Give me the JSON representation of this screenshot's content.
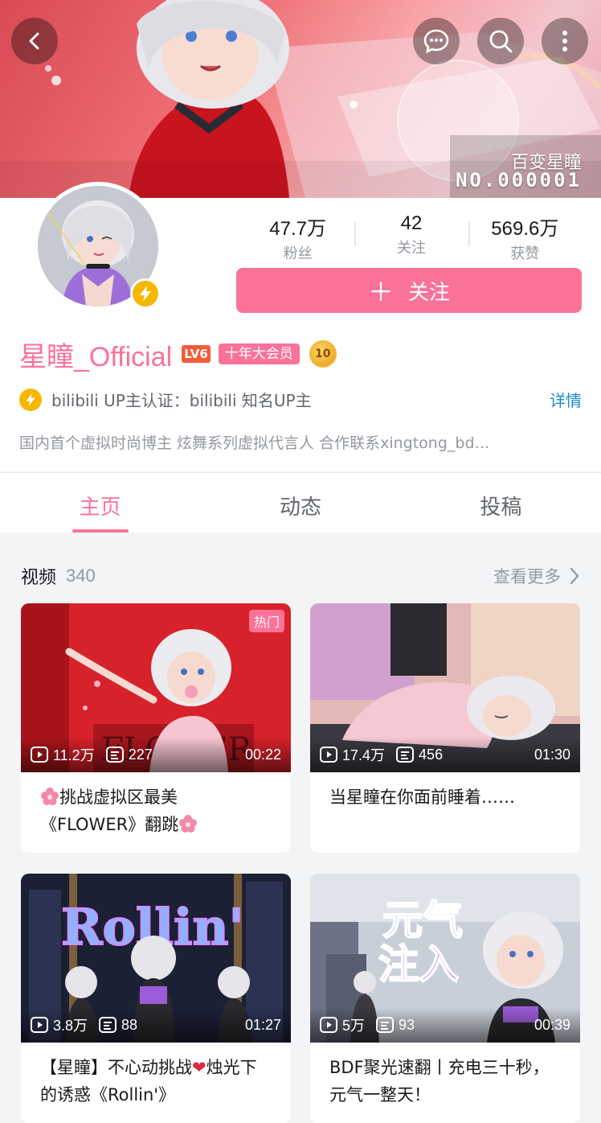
{
  "banner": {
    "badge_name": "百变星瞳",
    "badge_no": "NO.000001"
  },
  "header": {
    "back_icon": "back-arrow-icon",
    "message_icon": "message-icon",
    "search_icon": "search-icon",
    "more_icon": "more-vertical-icon"
  },
  "stats": [
    {
      "value": "47.7万",
      "label": "粉丝"
    },
    {
      "value": "42",
      "label": "关注"
    },
    {
      "value": "569.6万",
      "label": "获赞"
    }
  ],
  "follow_button": {
    "plus": "＋",
    "label": "关注"
  },
  "user": {
    "name": "星瞳_Official",
    "level": "LV6",
    "vip": "十年大会员",
    "medal": "10"
  },
  "verify": {
    "text": "bilibili UP主认证：bilibili 知名UP主",
    "detail_link": "详情"
  },
  "bio": "国内首个虚拟时尚博主 炫舞系列虚拟代言人 合作联系xingtong_bd…",
  "tabs": [
    "主页",
    "动态",
    "投稿"
  ],
  "videos": {
    "title": "视频",
    "count": "340",
    "more": "查看更多",
    "items": [
      {
        "plays": "11.2万",
        "danmaku": "227",
        "duration": "00:22",
        "badge": "热门",
        "title_a": "挑战虚拟区最美",
        "title_b": "《FLOWER》翻跳"
      },
      {
        "plays": "17.4万",
        "danmaku": "456",
        "duration": "01:30",
        "title": "当星瞳在你面前睡着……"
      },
      {
        "plays": "3.8万",
        "danmaku": "88",
        "duration": "01:27",
        "title_a": "【星瞳】不心动挑战",
        "title_b": "烛光下的诱惑《Rollin'》"
      },
      {
        "plays": "5万",
        "danmaku": "93",
        "duration": "00:39",
        "title": "BDF聚光速翻丨充电三十秒，元气一整天！"
      }
    ]
  },
  "colors": {
    "accent": "#fb7299",
    "link": "#178bcf",
    "gold": "#f6b700"
  }
}
